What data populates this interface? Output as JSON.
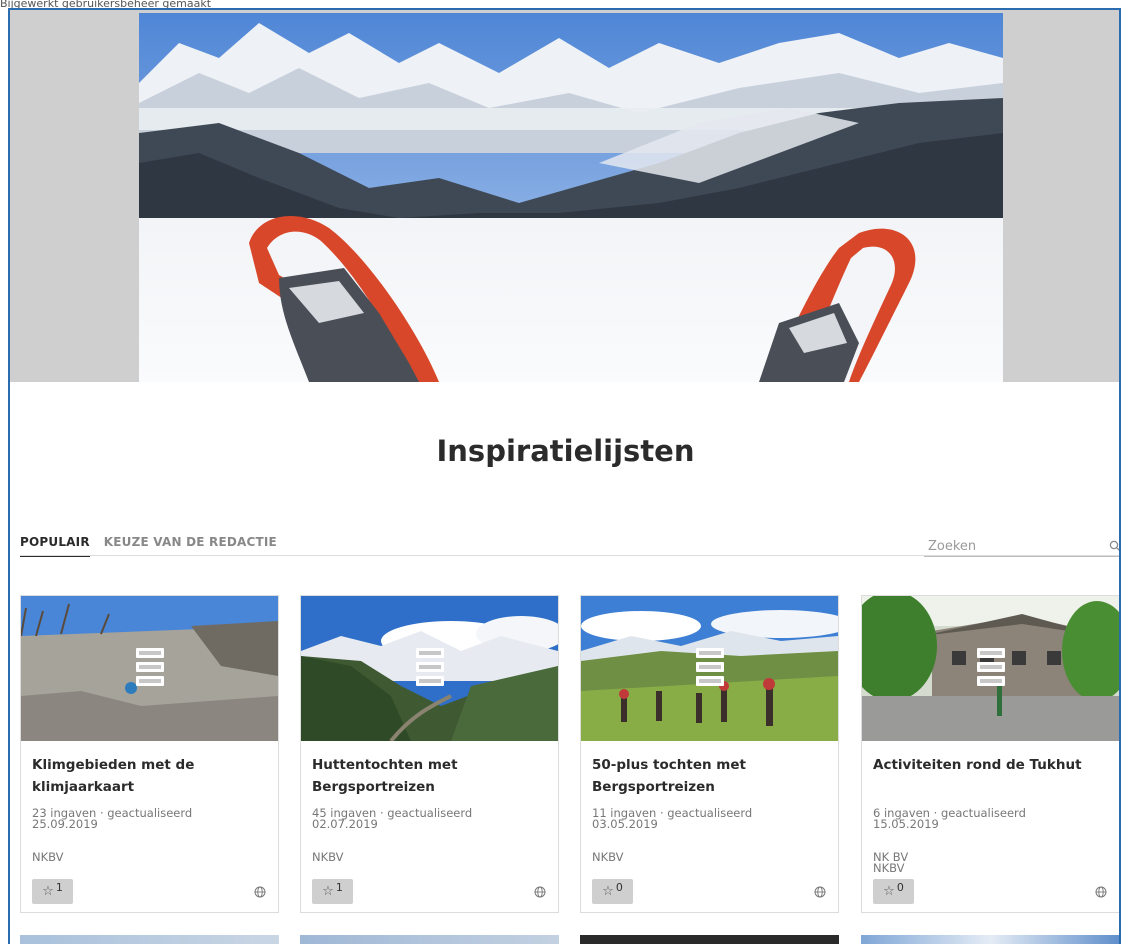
{
  "top_strip_text": "Bijgewerkt gebruikersbeheer gemaakt",
  "hero": {
    "alt": "snowshoes-mountain-view"
  },
  "page": {
    "title": "Inspiratielijsten"
  },
  "tabs": [
    {
      "label": "POPULAIR",
      "active": true
    },
    {
      "label": "KEUZE VAN DE REDACTIE",
      "active": false
    }
  ],
  "search": {
    "placeholder": "Zoeken"
  },
  "cards": [
    {
      "title": "Klimgebieden met de klimjaarkaart",
      "meta_line1": "23 ingaven · geactualiseerd",
      "meta_line2": "25.09.2019",
      "owner_line1": "NKBV",
      "owner_line2": "",
      "stars": "1"
    },
    {
      "title": "Huttentochten met Bergsportreizen",
      "meta_line1": "45 ingaven · geactualiseerd",
      "meta_line2": "02.07.2019",
      "owner_line1": "NKBV",
      "owner_line2": "",
      "stars": "1"
    },
    {
      "title": "50-plus tochten met Bergsportreizen",
      "meta_line1": "11 ingaven · geactualiseerd",
      "meta_line2": "03.05.2019",
      "owner_line1": "NKBV",
      "owner_line2": "",
      "stars": "0"
    },
    {
      "title": "Activiteiten rond de Tukhut",
      "meta_line1": "6 ingaven · geactualiseerd",
      "meta_line2": "15.05.2019",
      "owner_line1": "NK BV",
      "owner_line2": "NKBV",
      "stars": "0"
    }
  ],
  "icons": {
    "search": "search-icon",
    "star": "star-icon",
    "globe": "globe-icon",
    "list": "list-icon"
  }
}
